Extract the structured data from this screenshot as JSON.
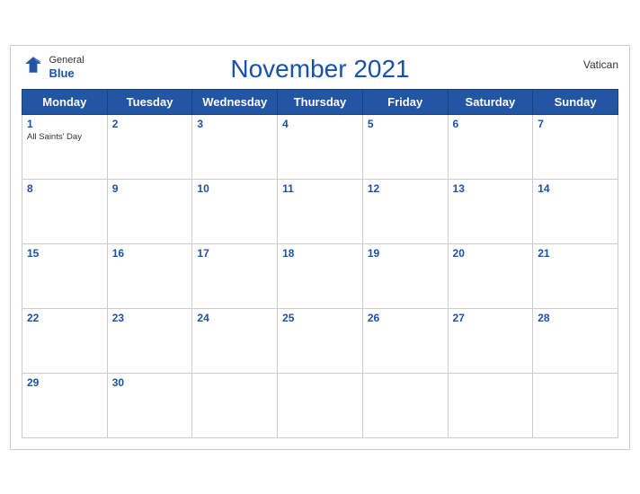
{
  "header": {
    "month_year": "November 2021",
    "country": "Vatican",
    "logo_line1": "General",
    "logo_line2": "Blue"
  },
  "weekdays": [
    "Monday",
    "Tuesday",
    "Wednesday",
    "Thursday",
    "Friday",
    "Saturday",
    "Sunday"
  ],
  "weeks": [
    [
      {
        "day": "1",
        "holiday": "All Saints' Day"
      },
      {
        "day": "2",
        "holiday": ""
      },
      {
        "day": "3",
        "holiday": ""
      },
      {
        "day": "4",
        "holiday": ""
      },
      {
        "day": "5",
        "holiday": ""
      },
      {
        "day": "6",
        "holiday": ""
      },
      {
        "day": "7",
        "holiday": ""
      }
    ],
    [
      {
        "day": "8",
        "holiday": ""
      },
      {
        "day": "9",
        "holiday": ""
      },
      {
        "day": "10",
        "holiday": ""
      },
      {
        "day": "11",
        "holiday": ""
      },
      {
        "day": "12",
        "holiday": ""
      },
      {
        "day": "13",
        "holiday": ""
      },
      {
        "day": "14",
        "holiday": ""
      }
    ],
    [
      {
        "day": "15",
        "holiday": ""
      },
      {
        "day": "16",
        "holiday": ""
      },
      {
        "day": "17",
        "holiday": ""
      },
      {
        "day": "18",
        "holiday": ""
      },
      {
        "day": "19",
        "holiday": ""
      },
      {
        "day": "20",
        "holiday": ""
      },
      {
        "day": "21",
        "holiday": ""
      }
    ],
    [
      {
        "day": "22",
        "holiday": ""
      },
      {
        "day": "23",
        "holiday": ""
      },
      {
        "day": "24",
        "holiday": ""
      },
      {
        "day": "25",
        "holiday": ""
      },
      {
        "day": "26",
        "holiday": ""
      },
      {
        "day": "27",
        "holiday": ""
      },
      {
        "day": "28",
        "holiday": ""
      }
    ],
    [
      {
        "day": "29",
        "holiday": ""
      },
      {
        "day": "30",
        "holiday": ""
      },
      {
        "day": "",
        "holiday": ""
      },
      {
        "day": "",
        "holiday": ""
      },
      {
        "day": "",
        "holiday": ""
      },
      {
        "day": "",
        "holiday": ""
      },
      {
        "day": "",
        "holiday": ""
      }
    ]
  ]
}
